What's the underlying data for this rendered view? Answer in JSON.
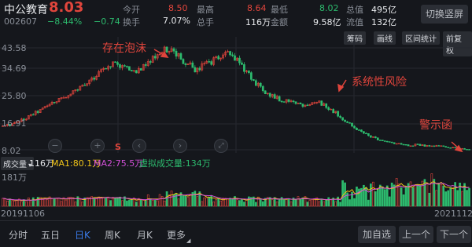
{
  "header": {
    "stock_name": "中公教育",
    "price": "8.03",
    "code": "002607",
    "change_pct": "−8.44%",
    "change_abs": "−0.74",
    "switch_button": "切换竖屏",
    "stats": [
      {
        "label": "今开",
        "value": "8.50"
      },
      {
        "label": "最高",
        "value": "8.64"
      },
      {
        "label": "最低",
        "value": "8.02"
      },
      {
        "label": "总值",
        "value": "495亿"
      },
      {
        "label": "换手",
        "value": "7.07%"
      },
      {
        "label": "总手",
        "value": "116万"
      },
      {
        "label": "金额",
        "value": "9.58亿"
      },
      {
        "label": "流值",
        "value": "132亿"
      }
    ]
  },
  "chart_tools": [
    "筹码",
    "画线",
    "区间统计",
    "前复权"
  ],
  "price_axis": [
    "43.58",
    "34.69",
    "25.80",
    "16.91",
    "8.02"
  ],
  "annotations": {
    "bubble": "存在泡沫",
    "risk": "系统性风险",
    "warning": "警示函"
  },
  "volume_bar": {
    "selector": "成交量",
    "volume": "116万",
    "ma1": "MA1:80.1万",
    "ma2": "MA2:75.5万",
    "virtual": "虚拟成交量:134万",
    "axis_top": "181万"
  },
  "dates": {
    "start": "20191106",
    "end": "20211120"
  },
  "period_tabs": [
    "分时",
    "五日",
    "日K",
    "周K",
    "月K",
    "更多"
  ],
  "active_tab": "日K",
  "actions": {
    "add": "加自选",
    "prev": "上一个",
    "next": "下一个"
  },
  "colors": {
    "up": "#e0453c",
    "down": "#2dbb6e",
    "ma1": "#f0c419",
    "ma2": "#d14fd6",
    "virtual": "#2dbb6e"
  },
  "icons": {
    "more": "dropdown-corner-icon",
    "minus": "zoom-out-icon",
    "plus": "zoom-in-icon",
    "back": "scroll-left-icon",
    "fwd": "scroll-right-icon",
    "full": "expand-icon"
  },
  "chart_data": {
    "type": "candlestick",
    "x": [
      "20191106",
      "20211120"
    ],
    "ylim": [
      8.02,
      43.58
    ],
    "close_path": [
      16.2,
      17.0,
      18.5,
      20.5,
      22.4,
      24.6,
      26.5,
      28.2,
      30.1,
      33.5,
      36.5,
      38.5,
      36.8,
      35.0,
      37.2,
      40.5,
      43.0,
      41.5,
      38.5,
      36.0,
      37.5,
      40.0,
      41.5,
      39.5,
      35.0,
      31.0,
      28.0,
      26.0,
      25.0,
      24.2,
      23.5,
      24.8,
      23.0,
      20.5,
      17.5,
      15.0,
      13.0,
      11.5,
      10.8,
      10.2,
      9.6,
      9.8,
      9.2,
      9.5,
      8.8,
      8.3,
      8.03
    ],
    "volume_max": "181万"
  }
}
